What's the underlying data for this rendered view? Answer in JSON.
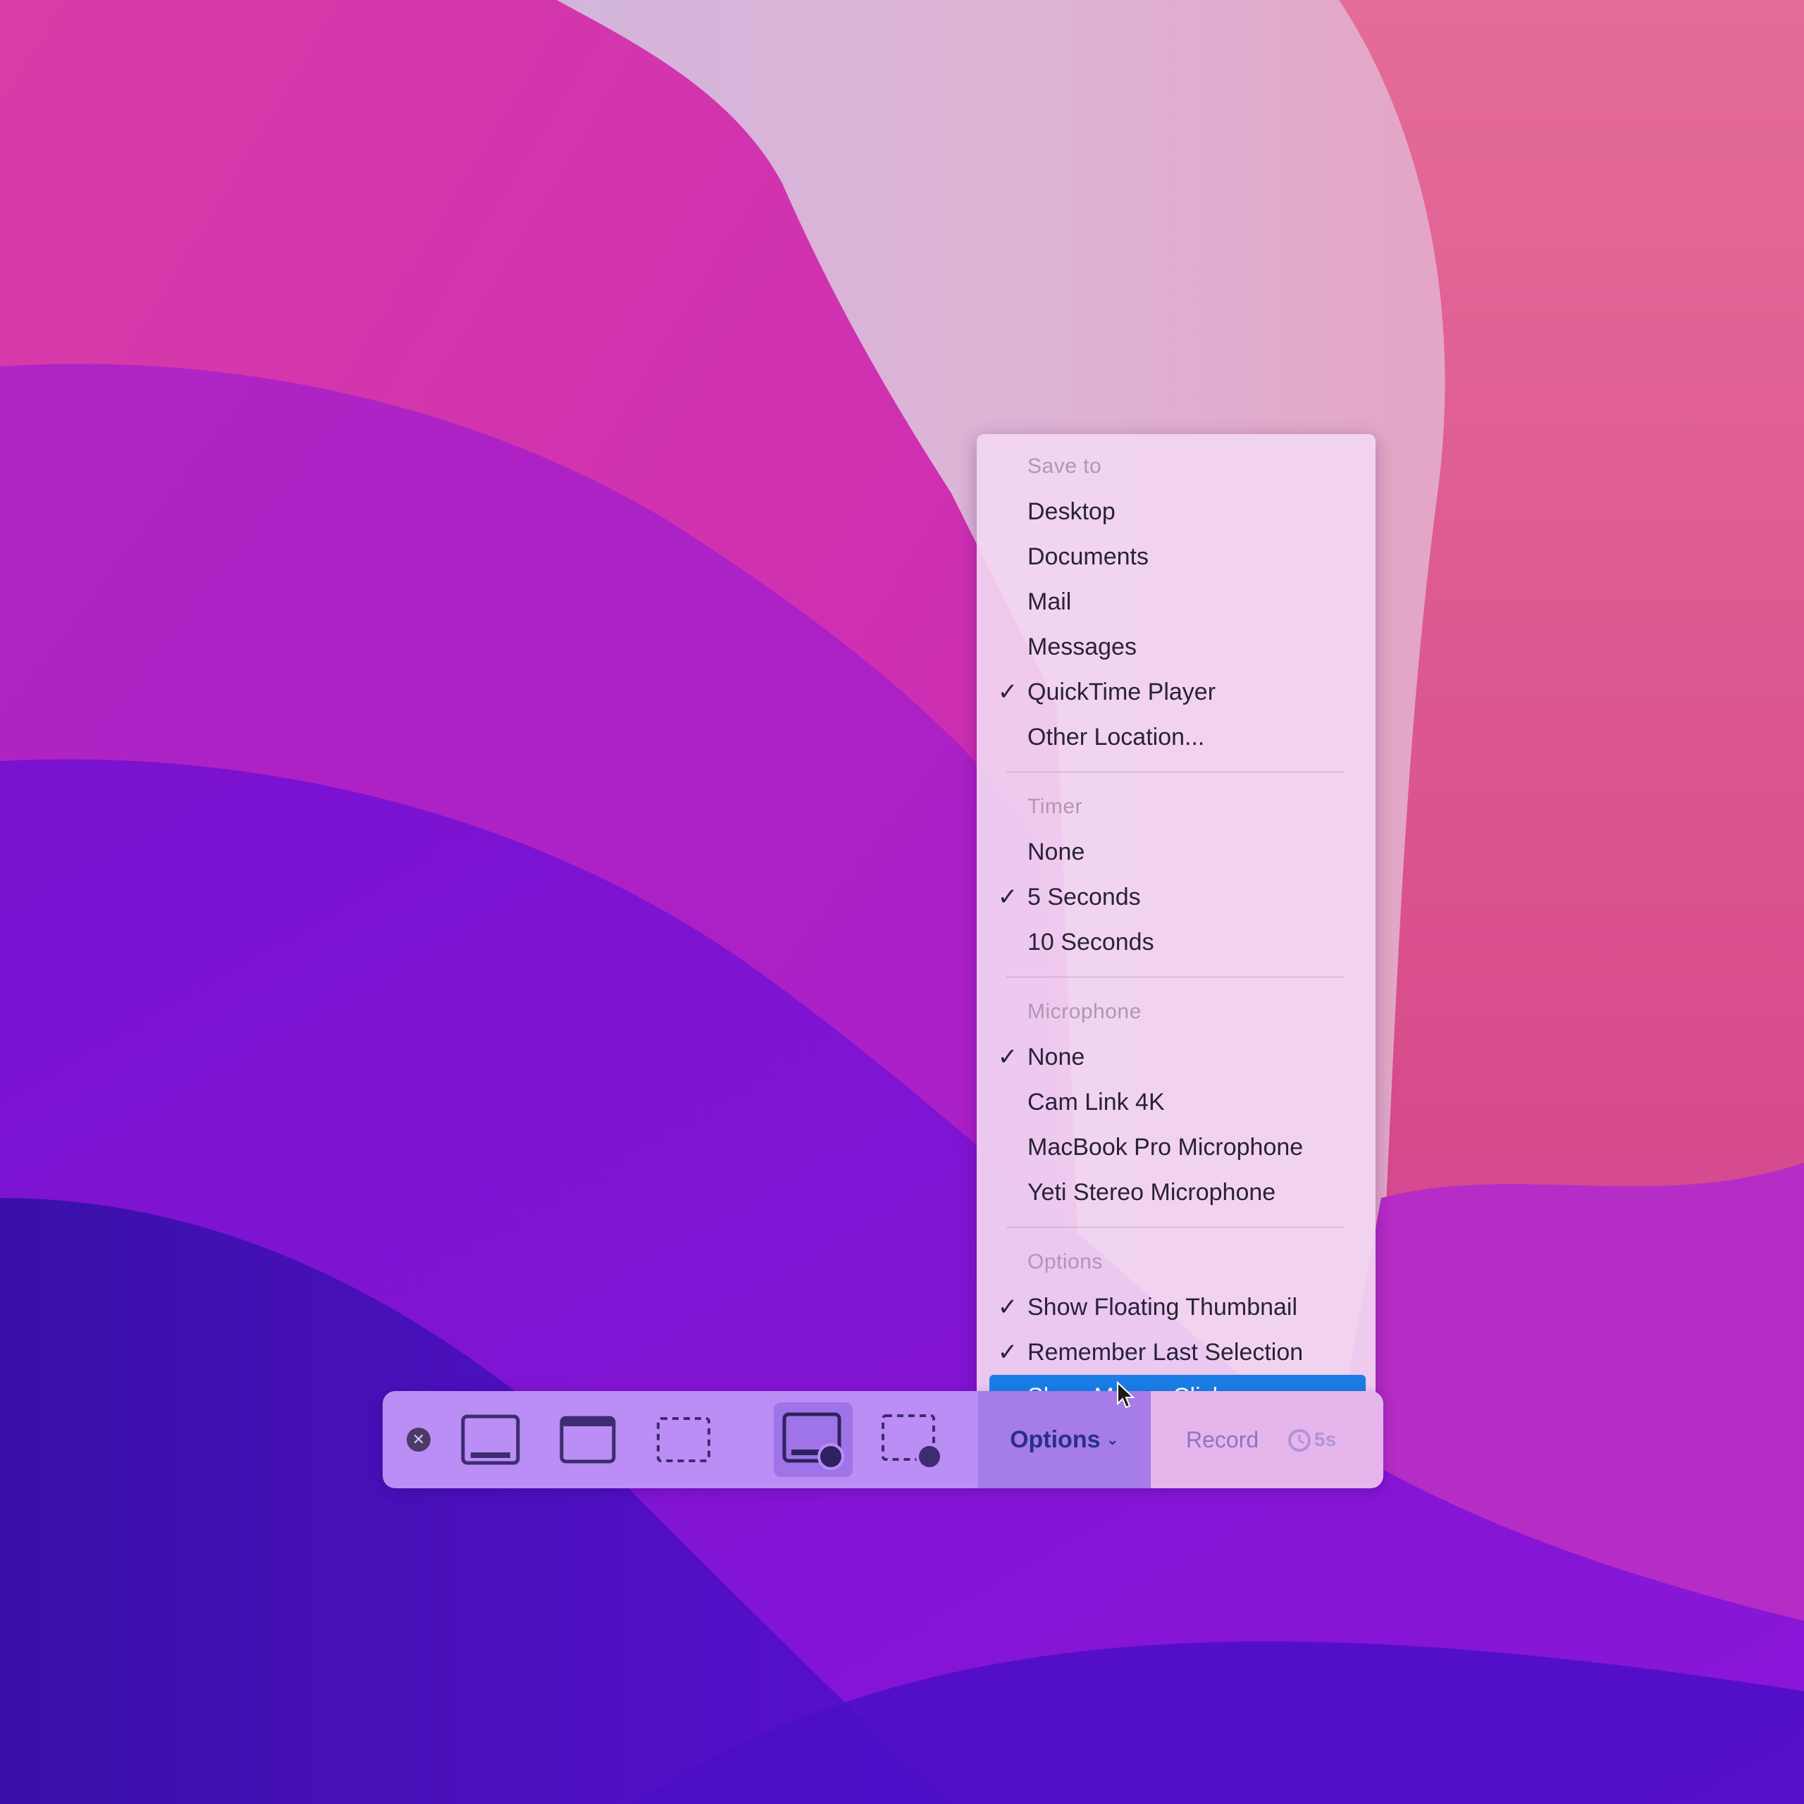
{
  "colors": {
    "highlight": "#1a7ee6",
    "menu_background": "#f2d6f2",
    "toolbar_background": "#bb8ef5",
    "options_text": "#2b2e8a"
  },
  "menu": {
    "sections": [
      {
        "header": "Save to",
        "items": [
          {
            "label": "Desktop",
            "checked": false
          },
          {
            "label": "Documents",
            "checked": false
          },
          {
            "label": "Mail",
            "checked": false
          },
          {
            "label": "Messages",
            "checked": false
          },
          {
            "label": "QuickTime Player",
            "checked": true
          },
          {
            "label": "Other Location...",
            "checked": false
          }
        ]
      },
      {
        "header": "Timer",
        "items": [
          {
            "label": "None",
            "checked": false
          },
          {
            "label": "5 Seconds",
            "checked": true
          },
          {
            "label": "10 Seconds",
            "checked": false
          }
        ]
      },
      {
        "header": "Microphone",
        "items": [
          {
            "label": "None",
            "checked": true
          },
          {
            "label": "Cam Link 4K",
            "checked": false
          },
          {
            "label": "MacBook Pro Microphone",
            "checked": false
          },
          {
            "label": "Yeti Stereo Microphone",
            "checked": false
          }
        ]
      },
      {
        "header": "Options",
        "items": [
          {
            "label": "Show Floating Thumbnail",
            "checked": true
          },
          {
            "label": "Remember Last Selection",
            "checked": true
          },
          {
            "label": "Show Mouse Clicks",
            "checked": false,
            "highlighted": true
          }
        ]
      }
    ],
    "check_glyph": "✓"
  },
  "toolbar": {
    "close_icon": "close-icon",
    "close_glyph": "✕",
    "tools": [
      {
        "name": "capture-entire-screen",
        "icon": "screen-icon"
      },
      {
        "name": "capture-selected-window",
        "icon": "window-icon"
      },
      {
        "name": "capture-selected-portion",
        "icon": "dashed-selection-icon"
      },
      {
        "name": "record-entire-screen",
        "icon": "screen-record-icon",
        "selected": true
      },
      {
        "name": "record-selected-portion",
        "icon": "dashed-record-icon"
      }
    ],
    "options_label": "Options",
    "options_chevron": "⌄",
    "record_label": "Record",
    "timer_label": "5s"
  }
}
